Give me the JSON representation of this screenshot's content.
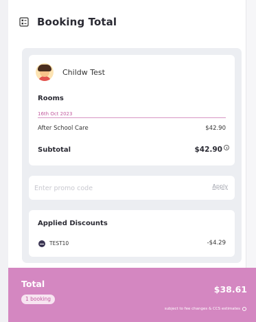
{
  "header": {
    "title": "Booking Total",
    "icon": "receipt-icon"
  },
  "child": {
    "name": "Childw Test",
    "avatar": "child-avatar"
  },
  "rooms": {
    "label": "Rooms",
    "date": "16th Oct 2023",
    "items": [
      {
        "name": "After School Care",
        "price": "$42.90"
      }
    ]
  },
  "subtotal": {
    "label": "Subtotal",
    "value": "$42.90"
  },
  "promo": {
    "placeholder": "Enter promo code",
    "value": "",
    "apply_label": "Apply"
  },
  "discounts": {
    "title": "Applied Discounts",
    "items": [
      {
        "code": "TEST10",
        "amount": "-$4.29"
      }
    ]
  },
  "total": {
    "label": "Total",
    "bookings_badge": "1 booking",
    "amount": "$38.61",
    "note": "subject to fee changes & CCS estimates"
  },
  "colors": {
    "accent_pink": "#d487c1",
    "date_pink": "#c15a9e",
    "panel_gray": "#eceef2"
  }
}
